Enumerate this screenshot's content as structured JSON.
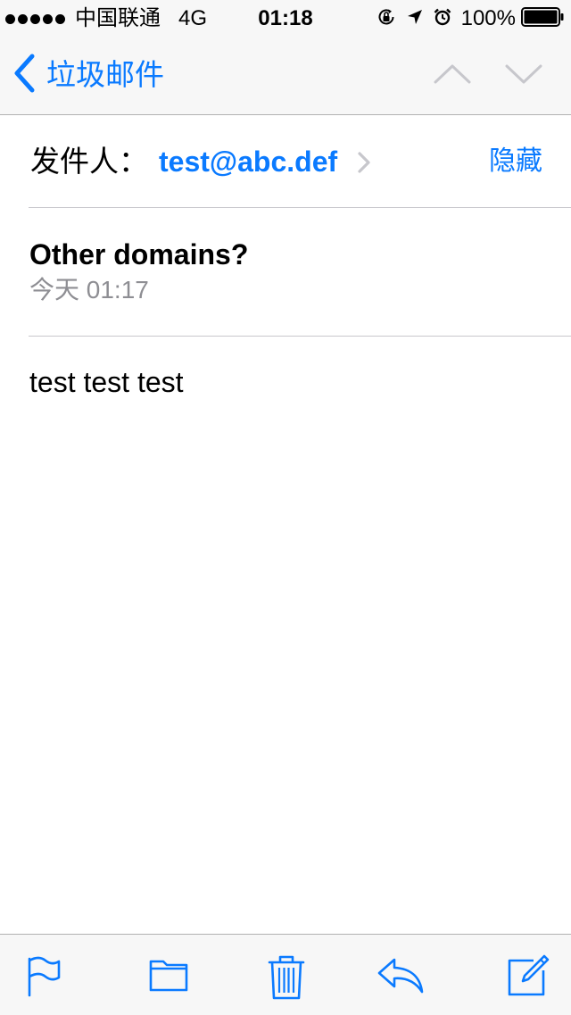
{
  "status_bar": {
    "carrier": "中国联通",
    "network": "4G",
    "time": "01:18",
    "battery": "100%",
    "signal_bars": 5,
    "icons": [
      "orientation-lock-icon",
      "location-arrow-icon",
      "alarm-icon",
      "battery-icon"
    ]
  },
  "nav_bar": {
    "back_label": "垃圾邮件",
    "icons": [
      "chevron-left-icon",
      "previous-message-icon",
      "next-message-icon"
    ]
  },
  "message": {
    "from_label": "发件人：",
    "from_address": "test@abc.def",
    "hide_label": "隐藏",
    "subject": "Other domains?",
    "date": "今天 01:17",
    "body": "test test test"
  },
  "toolbar": {
    "icons": [
      "flag-icon",
      "folder-icon",
      "trash-icon",
      "reply-icon",
      "compose-icon"
    ]
  },
  "colors": {
    "accent": "#0a7aff",
    "bar_background": "#f7f7f7",
    "secondary_text": "#8e8e93",
    "separator": "#c8c7cc",
    "disabled_arrow": "#c7c7cc"
  }
}
